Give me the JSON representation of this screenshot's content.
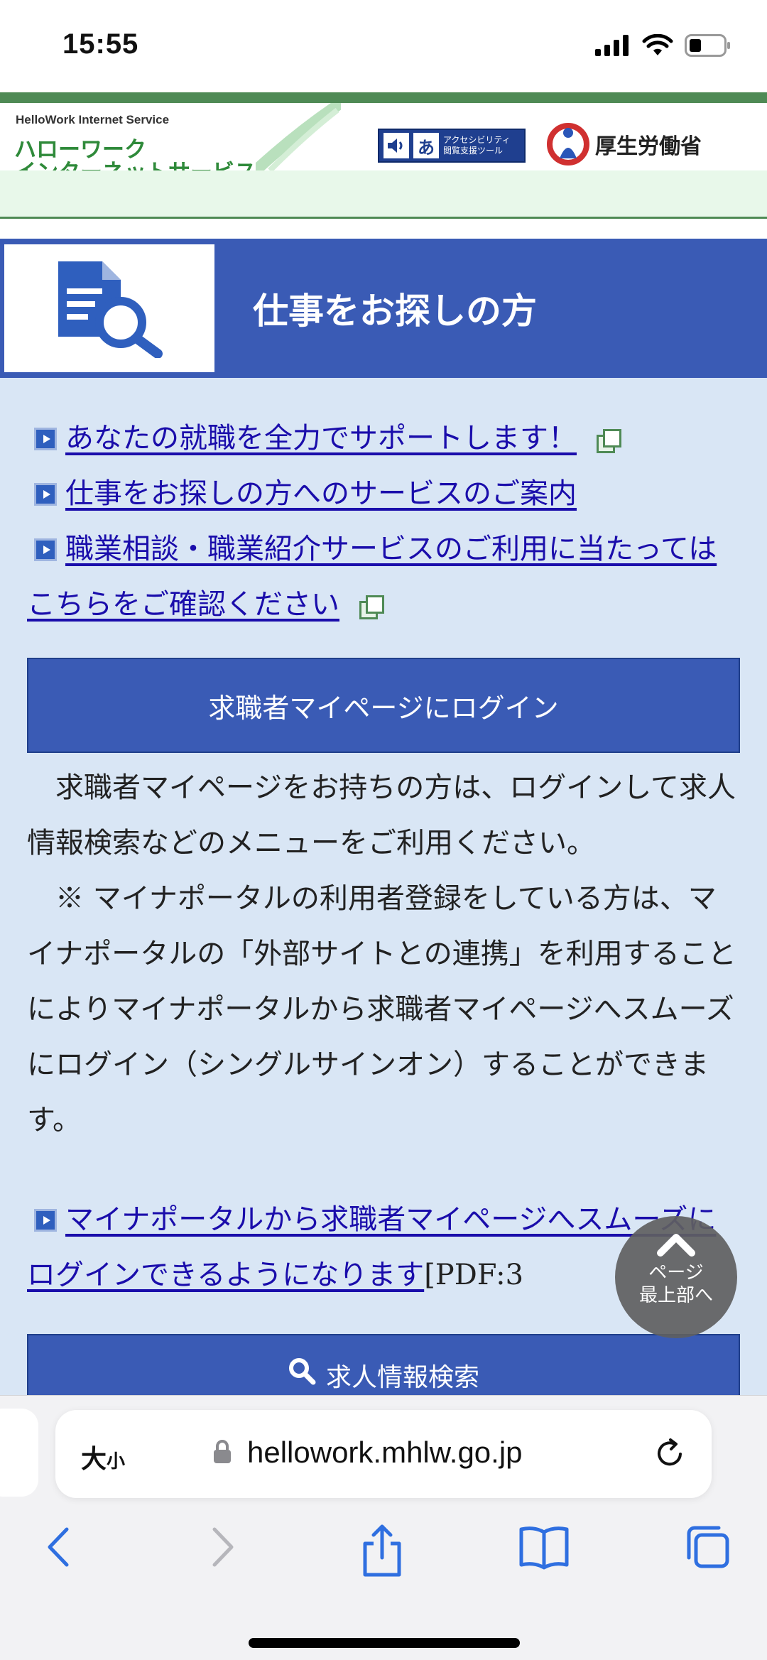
{
  "status_bar": {
    "time": "15:55"
  },
  "header": {
    "logo_small": "HelloWork Internet Service",
    "logo_line1": "ハローワーク",
    "logo_line2": "インターネットサービス",
    "a11y_label_1": "アクセシビリティ",
    "a11y_label_2": "閲覧支援ツール",
    "a11y_glyph": "あ",
    "ministry": "厚生労働省"
  },
  "title_band": {
    "title": "仕事をお探しの方"
  },
  "links": [
    {
      "label": "あなたの就職を全力でサポートします！",
      "external": true
    },
    {
      "label": "仕事をお探しの方へのサービスのご案内",
      "external": false
    },
    {
      "label": "職業相談・職業紹介サービスのご利用に当たってはこちらをご確認ください",
      "external": true
    }
  ],
  "login_button": {
    "label": "求職者マイページにログイン"
  },
  "body_text": {
    "p1": "　求職者マイページをお持ちの方は、ログインして求人情報検索などのメニューをご利用ください。",
    "p2": "　※ マイナポータルの利用者登録をしている方は、マイナポータルの「外部サイトとの連携」を利用することによりマイナポータルから求職者マイページへスムーズにログイン（シングルサインオン）することができます。"
  },
  "pdf_link": {
    "label": "マイナポータルから求職者マイページへスムーズにログインできるようになります",
    "suffix": "[PDF:3"
  },
  "search_button": {
    "label": "求人情報検索"
  },
  "to_top": {
    "line1": "ページ",
    "line2": "最上部へ"
  },
  "browser": {
    "text_size_label": "大",
    "text_size_small": "小",
    "url": "hellowork.mhlw.go.jp"
  },
  "colors": {
    "primary_blue": "#3a5bb5",
    "content_bg": "#d9e6f5",
    "brand_green": "#4f8a55",
    "link": "#1a0dab"
  }
}
